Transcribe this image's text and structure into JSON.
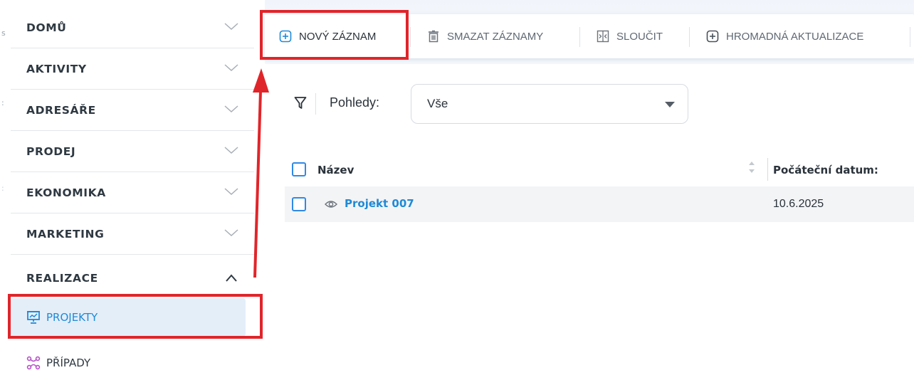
{
  "sidebar": {
    "items": [
      {
        "label": "DOMŮ",
        "icon": "chevron-down-icon"
      },
      {
        "label": "AKTIVITY",
        "icon": "chevron-down-icon"
      },
      {
        "label": "ADRESÁŘE",
        "icon": "chevron-down-icon"
      },
      {
        "label": "PRODEJ",
        "icon": "chevron-down-icon"
      },
      {
        "label": "EKONOMIKA",
        "icon": "chevron-down-icon"
      },
      {
        "label": "MARKETING",
        "icon": "chevron-down-icon"
      },
      {
        "label": "REALIZACE",
        "icon": "chevron-up-icon",
        "expanded": true
      }
    ],
    "sub_items": [
      {
        "label": "PROJEKTY",
        "icon": "presentation-icon",
        "active": true,
        "color": "#1f8ad6"
      },
      {
        "label": "PŘÍPADY",
        "icon": "network-icon",
        "active": false,
        "color": "#2f3942",
        "icon_color": "#b84fc9"
      }
    ]
  },
  "toolbar": {
    "new_record": {
      "label": "NOVÝ ZÁZNAM",
      "icon": "plus-square-icon"
    },
    "delete_records": {
      "label": "SMAZAT ZÁZNAMY",
      "icon": "trash-icon"
    },
    "merge": {
      "label": "SLOUČIT",
      "icon": "merge-icon"
    },
    "bulk_update": {
      "label": "HROMADNÁ AKTUALIZACE",
      "icon": "plus-square-icon"
    }
  },
  "views": {
    "label": "Pohledy:",
    "selected": "Vše",
    "filter_icon": "filter-icon"
  },
  "table": {
    "columns": [
      "Název",
      "Počáteční datum:"
    ],
    "rows": [
      {
        "name": "Projekt 007",
        "start_date": "10.6.2025",
        "icon": "eye-icon"
      }
    ]
  },
  "colors": {
    "accent": "#1f8ad6",
    "checkbox": "#2f8ae5",
    "annotation": "#e0252a",
    "active_bg": "#e4eef9"
  }
}
